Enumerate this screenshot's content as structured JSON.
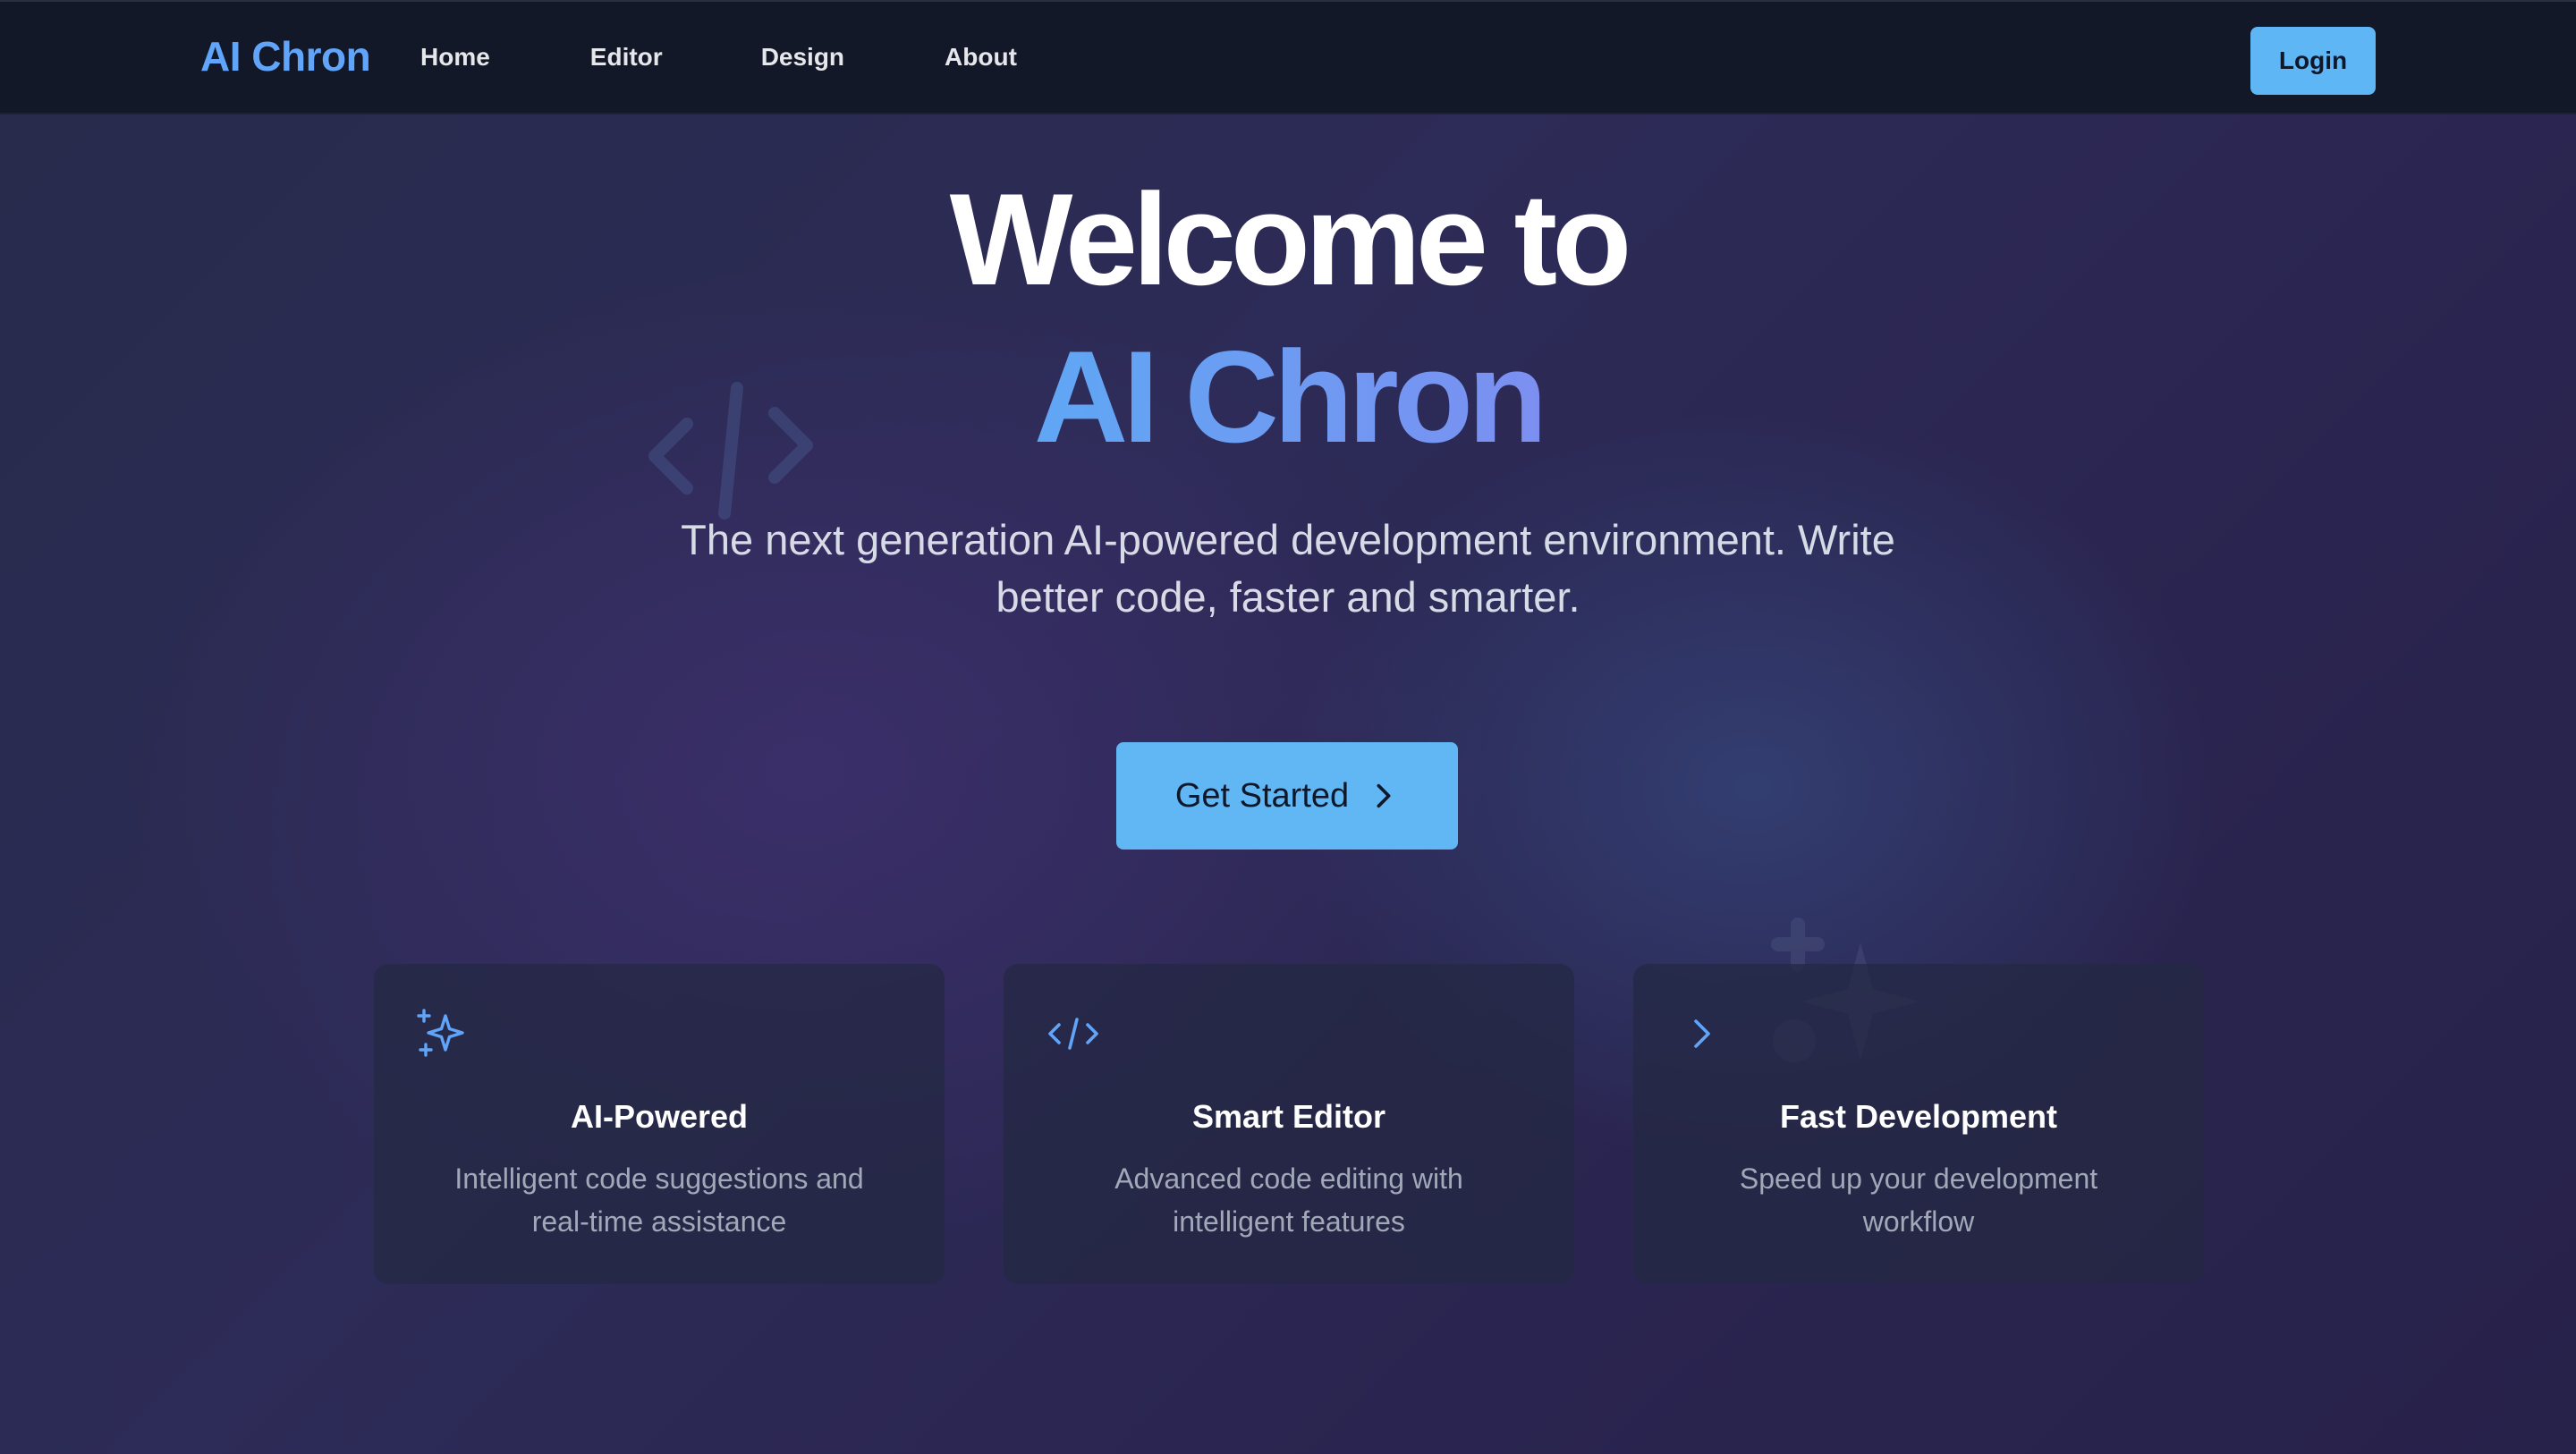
{
  "nav": {
    "brand": "AI Chron",
    "links": [
      "Home",
      "Editor",
      "Design",
      "About"
    ],
    "login_label": "Login"
  },
  "hero": {
    "title_line1": "Welcome to",
    "title_line2": "AI Chron",
    "subtitle": "The next generation AI-powered development environment. Write better code, faster and smarter.",
    "cta_label": "Get Started",
    "cta_icon": "chevron-right-icon"
  },
  "features": [
    {
      "icon": "sparkles-icon",
      "title": "AI-Powered",
      "description": "Intelligent code suggestions and real-time assistance"
    },
    {
      "icon": "code-icon",
      "title": "Smart Editor",
      "description": "Advanced code editing with intelligent features"
    },
    {
      "icon": "chevron-right-icon",
      "title": "Fast Development",
      "description": "Speed up your development workflow"
    }
  ],
  "colors": {
    "accent": "#60a5fa",
    "button": "#60b7f4",
    "navbar_bg": "#121827",
    "page_bg": "#2b2a52",
    "card_bg": "#242842"
  }
}
